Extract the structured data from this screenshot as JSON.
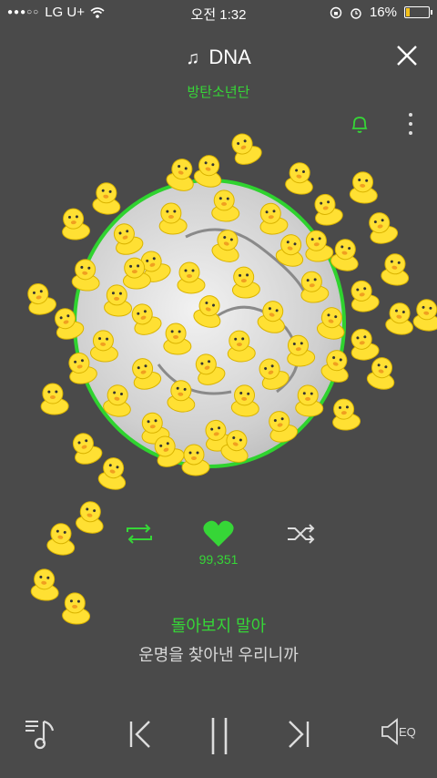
{
  "status_bar": {
    "carrier": "LG U+",
    "time": "오전 1:32",
    "battery": "16%",
    "battery_level": 0.16
  },
  "player": {
    "song_title": "DNA",
    "artist": "방탄소년단",
    "like_count": "99,351",
    "lyrics": {
      "current": "돌아보지 말아",
      "next": "운명을 찾아낸 우리니까"
    },
    "eq_label": "EQ"
  },
  "colors": {
    "accent": "#36d637",
    "background": "#4a4a4a",
    "duck": "#ffe033"
  },
  "icons": [
    "music-note-icon",
    "close-icon",
    "bell-icon",
    "more-icon",
    "repeat-icon",
    "heart-icon",
    "shuffle-icon",
    "playlist-icon",
    "previous-icon",
    "pause-icon",
    "next-icon",
    "eq-icon",
    "duck-sticker-icon"
  ]
}
